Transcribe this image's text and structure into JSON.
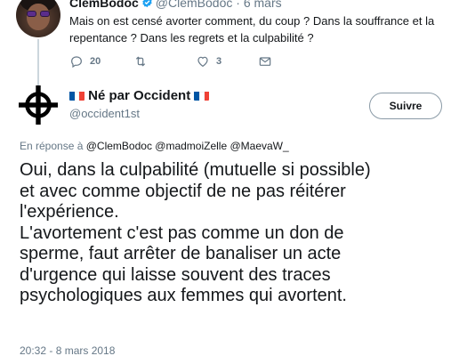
{
  "parent_tweet": {
    "author_name": "ClemBodoc",
    "author_handle": "@ClemBodoc",
    "separator": "·",
    "date": "6 mars",
    "text": "Mais on est censé avorter comment, du coup ? Dans la souffrance et la repentance ? Dans les regrets et la culpabilité ?",
    "reply_count": "20",
    "like_count": "3",
    "icons": {
      "reply": "reply-icon",
      "retweet": "retweet-icon",
      "like": "heart-icon",
      "dm": "envelope-icon",
      "verified": "verified-badge-icon"
    }
  },
  "main_tweet": {
    "author_name": "Né par Occident",
    "author_handle": "@occident1st",
    "follow_label": "Suivre",
    "reply_prefix": "En réponse à",
    "reply_mentions": "@ClemBodoc @madmoiZelle @MaevaW_",
    "text_lines": [
      "Oui, dans la culpabilité (mutuelle si possible)",
      "et avec comme objectif de ne pas réitérer",
      "l'expérience.",
      "L'avortement c'est pas comme un don de",
      "sperme, faut arrêter de banaliser un acte",
      "d'urgence qui laisse souvent des traces",
      "psychologiques aux femmes qui avortent."
    ],
    "timestamp": "20:32 - 8 mars 2018",
    "icons": {
      "avatar": "celtic-cross-icon",
      "flag": "france-flag-icon"
    }
  },
  "colors": {
    "text": "#14171a",
    "muted": "#657786",
    "verified": "#1da1f2",
    "flag_blue": "#0055a4",
    "flag_red": "#ef4135"
  }
}
